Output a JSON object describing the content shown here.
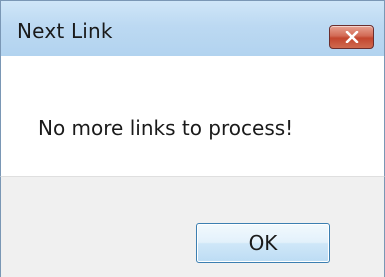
{
  "window": {
    "title": "Next Link",
    "close_icon": "close-icon"
  },
  "dialog": {
    "message": "No more links to process!",
    "ok_label": "OK"
  },
  "colors": {
    "titlebar": "#bcd9f2",
    "close_button": "#c3462f",
    "footer": "#f0f0f0",
    "ok_border": "#3c7fb1"
  }
}
